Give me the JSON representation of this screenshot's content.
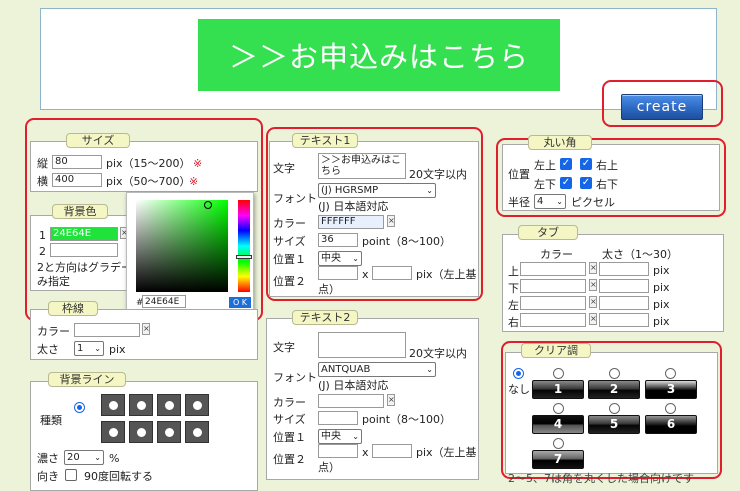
{
  "preview": {
    "button_text": "＞＞お申込みはこちら"
  },
  "create_button": "create",
  "size": {
    "legend": "サイズ",
    "height_label": "縦",
    "height_value": "80",
    "height_range": "pix（15〜200）",
    "width_label": "横",
    "width_value": "400",
    "width_range": "pix（50〜700）",
    "required_mark": "※"
  },
  "background": {
    "legend": "背景色",
    "row1_num": "1",
    "row1_value": "24E64E",
    "row2_num": "2",
    "note_line1": "2と方向はグラデー",
    "note_line2": "み指定"
  },
  "color_picker": {
    "hash": "#",
    "hex_value": "24E64E",
    "ok_label": "O K"
  },
  "border": {
    "legend": "枠線",
    "color_label": "カラー",
    "weight_label": "太さ",
    "weight_value": "1",
    "weight_unit": "pix"
  },
  "bg_line": {
    "legend": "背景ライン",
    "kind_label": "種類",
    "density_label": "濃さ",
    "density_value": "20",
    "density_unit": "%",
    "direction_label": "向き",
    "rotate_label": "90度回転する"
  },
  "text1": {
    "legend": "テキスト1",
    "text_label": "文字",
    "text_value_line1": "＞＞お申込みはこ",
    "text_value_line2": "ちら",
    "text_limit": "20文字以内",
    "font_label": "フォント",
    "font_value": "(J) HGRSMP",
    "font_note": "(J) 日本語対応",
    "color_label": "カラー",
    "color_value": "FFFFFF",
    "size_label": "サイズ",
    "size_value": "36",
    "size_range": "point（8〜100）",
    "pos1_label": "位置１",
    "pos1_value": "中央",
    "pos2_label": "位置２",
    "pos2_x": "x",
    "pos2_note_line1": "pix（左上基",
    "pos2_note_line2": "点）"
  },
  "text2": {
    "legend": "テキスト2",
    "text_label": "文字",
    "text_limit": "20文字以内",
    "font_label": "フォント",
    "font_value": "ANTQUAB",
    "font_note": "(J) 日本語対応",
    "color_label": "カラー",
    "size_label": "サイズ",
    "size_range": "point（8〜100）",
    "pos1_label": "位置１",
    "pos1_value": "中央",
    "pos2_label": "位置２",
    "pos2_x": "x",
    "pos2_note_line1": "pix（左上基",
    "pos2_note_line2": "点）"
  },
  "corner": {
    "legend": "丸い角",
    "pos_label": "位置",
    "top_left": "左上",
    "top_right": "右上",
    "bottom_left": "左下",
    "bottom_right": "右下",
    "radius_label": "半径",
    "radius_value": "4",
    "radius_unit": "ピクセル"
  },
  "tab": {
    "legend": "タブ",
    "color_header": "カラー",
    "weight_header": "太さ（1〜30）",
    "rows": [
      "上",
      "下",
      "左",
      "右"
    ],
    "unit": "pix"
  },
  "clear": {
    "legend": "クリア調",
    "none_label": "なし",
    "styles": [
      "1",
      "2",
      "3",
      "4",
      "5",
      "6",
      "7"
    ],
    "footnote": "2〜5、7は角を丸くした場合向けです"
  }
}
